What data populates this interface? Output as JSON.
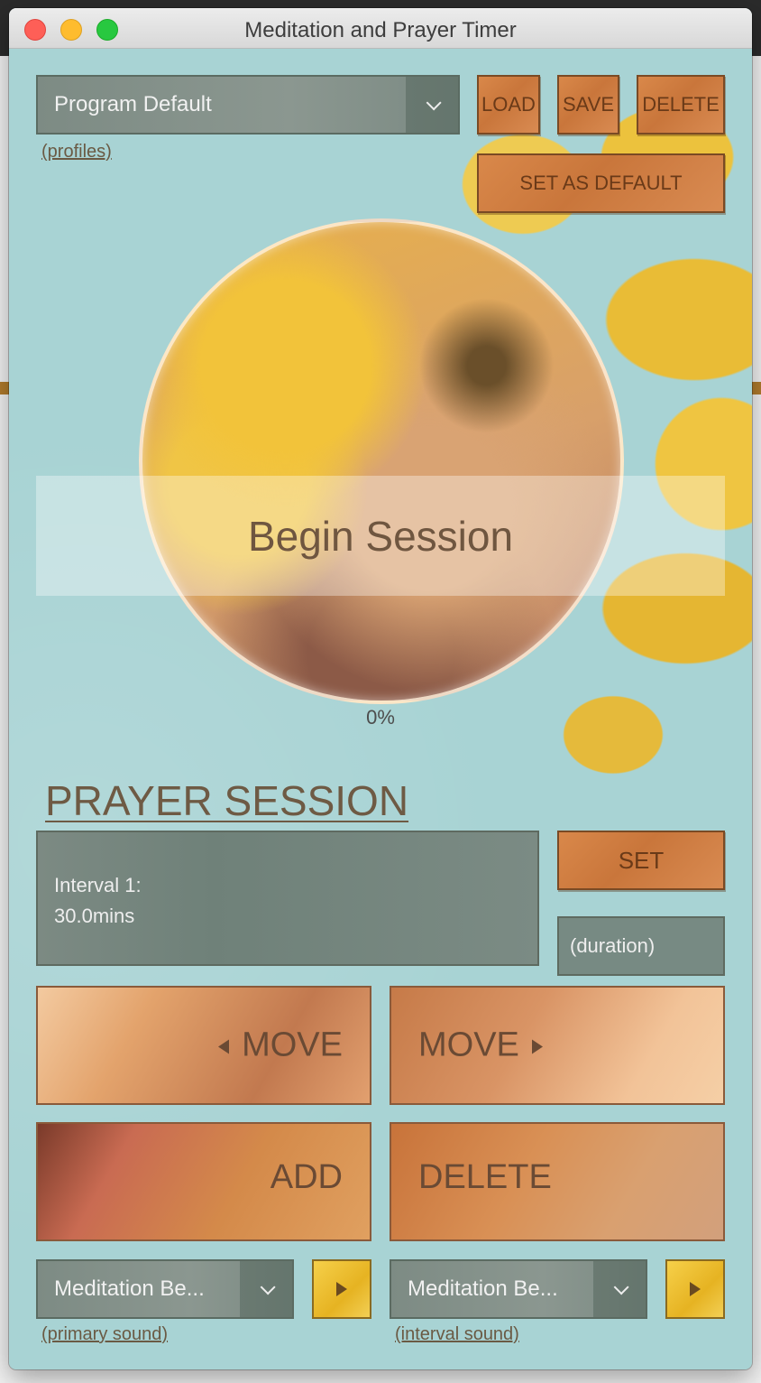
{
  "window": {
    "title": "Meditation and Prayer Timer"
  },
  "profile": {
    "selected": "Program Default",
    "link": "(profiles)",
    "load": "LOAD",
    "save": "SAVE",
    "delete": "DELETE",
    "set_default": "SET AS DEFAULT"
  },
  "session": {
    "begin": "Begin Session",
    "progress": "0%"
  },
  "prayer": {
    "title": "PRAYER SESSION",
    "interval_label": "Interval 1:",
    "interval_value": "30.0mins",
    "set": "SET",
    "duration_placeholder": "(duration)",
    "move_left": "MOVE",
    "move_right": "MOVE",
    "add": "ADD",
    "delete": "DELETE"
  },
  "sounds": {
    "primary_selected": "Meditation Be...",
    "primary_link": "(primary sound)",
    "interval_selected": "Meditation Be...",
    "interval_link": "(interval sound)"
  }
}
